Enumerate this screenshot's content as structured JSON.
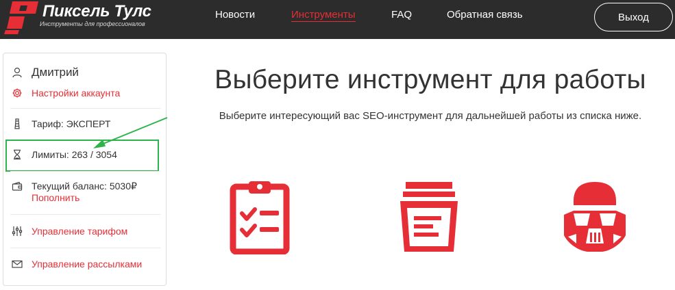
{
  "header": {
    "logo_title": "Пиксель Тулс",
    "logo_subtitle": "Инструменты для профессионалов",
    "nav": [
      {
        "label": "Новости",
        "active": false
      },
      {
        "label": "Инструменты",
        "active": true
      },
      {
        "label": "FAQ",
        "active": false
      },
      {
        "label": "Обратная связь",
        "active": false
      }
    ],
    "logout_label": "Выход"
  },
  "sidebar": {
    "user_name": "Дмитрий",
    "account_settings": "Настройки аккаунта",
    "tariff": "Тариф: ЭКСПЕРТ",
    "limits": "Лимиты: 263 / 3054",
    "balance": "Текущий баланс: 5030₽",
    "top_up": "Пополнить",
    "manage_tariff": "Управление тарифом",
    "manage_mailing": "Управление рассылками"
  },
  "main": {
    "title": "Выберите инструмент для работы",
    "subtitle": "Выберите интересующий вас SEO-инструмент для дальнейшей работы из списка ниже."
  },
  "colors": {
    "accent": "#e62e36",
    "header_bg": "#2c2c2c",
    "highlight": "#2db34a"
  },
  "icons": {
    "tools": [
      "clipboard-checklist-icon",
      "document-stack-icon",
      "stormtrooper-helmet-icon"
    ]
  }
}
